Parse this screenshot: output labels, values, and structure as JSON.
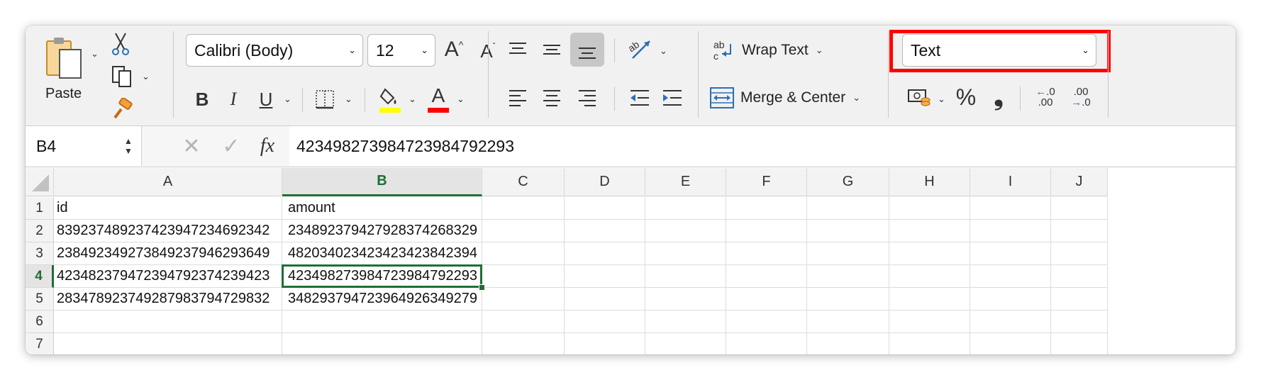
{
  "ribbon": {
    "clipboard": {
      "paste_label": "Paste"
    },
    "font": {
      "family": "Calibri (Body)",
      "size": "12",
      "increase_glyph": "A",
      "decrease_glyph": "A",
      "bold": "B",
      "italic": "I",
      "underline": "U",
      "font_color_glyph": "A",
      "highlight_color": "#ffff00",
      "font_color": "#ff0000"
    },
    "alignment": {
      "wrap_text_label": "Wrap Text",
      "merge_center_label": "Merge & Center"
    },
    "number": {
      "format": "Text",
      "percent": "%",
      "comma": "❟",
      "increase_decimal": [
        ".0",
        ".00"
      ],
      "decrease_decimal": [
        ".00",
        ".0"
      ]
    }
  },
  "formula_bar": {
    "name_box": "B4",
    "fx": "fx",
    "content": "423498273984723984792293"
  },
  "grid": {
    "columns": [
      "A",
      "B",
      "C",
      "D",
      "E",
      "F",
      "G",
      "H",
      "I",
      "J"
    ],
    "selected_column": "B",
    "selected_row": "4",
    "rows": [
      {
        "num": "1",
        "cells": [
          "id",
          "amount"
        ]
      },
      {
        "num": "2",
        "cells": [
          "839237489237423947234692342",
          "234892379427928374268329"
        ]
      },
      {
        "num": "3",
        "cells": [
          "238492349273849237946293649",
          "482034023423423423842394"
        ]
      },
      {
        "num": "4",
        "cells": [
          "423482379472394792374239423",
          "423498273984723984792293"
        ]
      },
      {
        "num": "5",
        "cells": [
          "283478923749287983794729832",
          "348293794723964926349279"
        ]
      },
      {
        "num": "6",
        "cells": [
          "",
          ""
        ]
      },
      {
        "num": "7",
        "cells": [
          "",
          ""
        ]
      }
    ]
  },
  "colors": {
    "accent_green": "#1e6e36",
    "highlight_red": "#ff0000"
  }
}
